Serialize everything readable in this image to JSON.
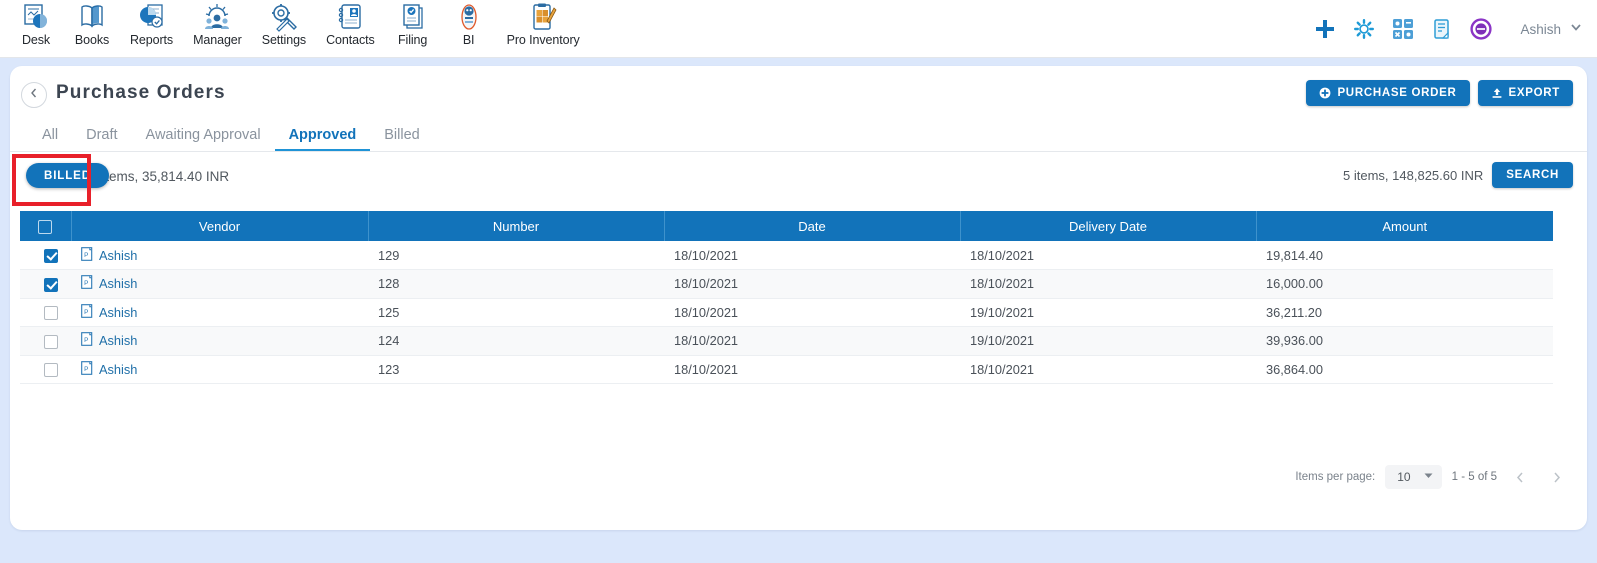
{
  "app_bar": {
    "modules": [
      {
        "label": "Desk",
        "icon": "desk-icon"
      },
      {
        "label": "Books",
        "icon": "books-icon"
      },
      {
        "label": "Reports",
        "icon": "reports-icon"
      },
      {
        "label": "Manager",
        "icon": "manager-icon"
      },
      {
        "label": "Settings",
        "icon": "settings-icon"
      },
      {
        "label": "Contacts",
        "icon": "contacts-icon"
      },
      {
        "label": "Filing",
        "icon": "filing-icon"
      },
      {
        "label": "BI",
        "icon": "bi-icon"
      },
      {
        "label": "Pro Inventory",
        "icon": "pro-inventory-icon"
      }
    ],
    "tools": [
      {
        "name": "add-icon"
      },
      {
        "name": "gear-icon"
      },
      {
        "name": "apps-grid-icon"
      },
      {
        "name": "notes-icon"
      },
      {
        "name": "badge-icon"
      }
    ],
    "user": {
      "name": "Ashish",
      "chevron": "chevron-down-icon"
    }
  },
  "header": {
    "back_icon": "chevron-left-icon",
    "title": "Purchase Orders",
    "actions": [
      {
        "label": "PURCHASE ORDER",
        "icon": "plus-circle-icon"
      },
      {
        "label": "EXPORT",
        "icon": "upload-icon"
      }
    ]
  },
  "tabs": [
    {
      "label": "All",
      "active": false
    },
    {
      "label": "Draft",
      "active": false
    },
    {
      "label": "Awaiting Approval",
      "active": false
    },
    {
      "label": "Approved",
      "active": true
    },
    {
      "label": "Billed",
      "active": false
    }
  ],
  "summary": {
    "billed_button": "BILLED",
    "selected_text": "2 items, 35,814.40 INR",
    "totals_text": "5 items, 148,825.60 INR",
    "search_button": "SEARCH"
  },
  "table": {
    "columns": [
      "Vendor",
      "Number",
      "Date",
      "Delivery Date",
      "Amount"
    ],
    "select_all_checked": false,
    "rows": [
      {
        "checked": true,
        "vendor": "Ashish",
        "number": "129",
        "date": "18/10/2021",
        "delivery_date": "18/10/2021",
        "amount": "19,814.40"
      },
      {
        "checked": true,
        "vendor": "Ashish",
        "number": "128",
        "date": "18/10/2021",
        "delivery_date": "18/10/2021",
        "amount": "16,000.00"
      },
      {
        "checked": false,
        "vendor": "Ashish",
        "number": "125",
        "date": "18/10/2021",
        "delivery_date": "19/10/2021",
        "amount": "36,211.20"
      },
      {
        "checked": false,
        "vendor": "Ashish",
        "number": "124",
        "date": "18/10/2021",
        "delivery_date": "19/10/2021",
        "amount": "39,936.00"
      },
      {
        "checked": false,
        "vendor": "Ashish",
        "number": "123",
        "date": "18/10/2021",
        "delivery_date": "18/10/2021",
        "amount": "36,864.00"
      }
    ]
  },
  "pagination": {
    "items_per_page_label": "Items per page:",
    "items_per_page_value": "10",
    "range": "1 - 5 of 5",
    "prev_icon": "chevron-left-icon",
    "next_icon": "chevron-right-icon"
  },
  "colors": {
    "accent": "#1273ba",
    "page_bg": "#dbe7fb",
    "annotation": "#e8202a",
    "tab_active": "#1f93d6"
  }
}
